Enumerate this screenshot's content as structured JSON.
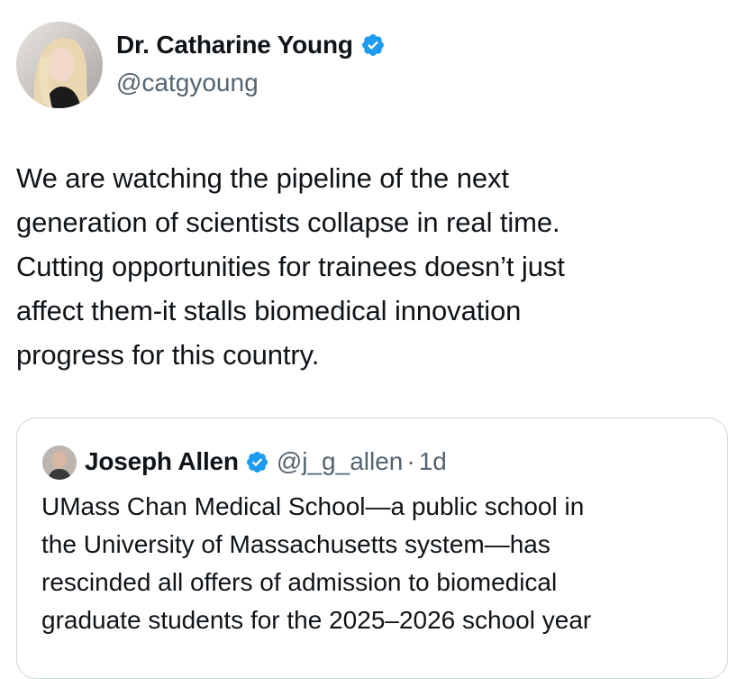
{
  "tweet": {
    "author": {
      "name": "Dr. Catharine Young",
      "handle": "@catgyoung",
      "verified": true,
      "avatar_icon": "profile-photo"
    },
    "text_lines": [
      "We are watching the pipeline of the next",
      "generation of scientists collapse in real time.",
      "Cutting opportunities for trainees doesn’t just",
      "affect them-it stalls biomedical innovation",
      "progress for this country."
    ]
  },
  "quoted_tweet": {
    "author": {
      "name": "Joseph Allen",
      "handle": "@j_g_allen",
      "separator": "·",
      "time": "1d",
      "verified": true,
      "avatar_icon": "profile-photo"
    },
    "text_lines": [
      "UMass Chan Medical School—a public school in",
      "the University of Massachusetts system—has",
      "rescinded all offers of admission to biomedical",
      "graduate students for the 2025–2026 school year"
    ]
  },
  "colors": {
    "text_primary": "#0f1419",
    "text_secondary": "#536471",
    "verified_blue": "#1d9bf0",
    "border": "#cfd9de"
  }
}
